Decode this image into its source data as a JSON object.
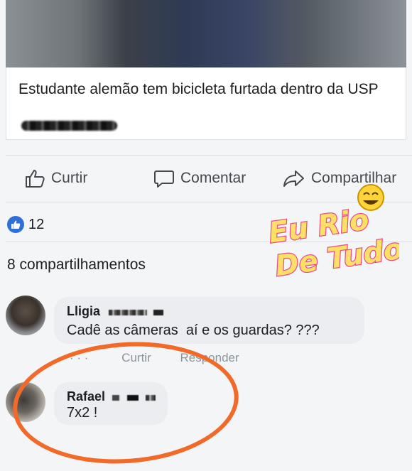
{
  "post": {
    "link_title": "Estudante alemão tem bicicleta furtada dentro da USP"
  },
  "actions": {
    "like_label": "Curtir",
    "comment_label": "Comentar",
    "share_label": "Compartilhar"
  },
  "reactions": {
    "count": "12"
  },
  "shares_text": "8 compartilhamentos",
  "comments": [
    {
      "name": "Lligia",
      "text": "Cadê as câmeras  aí e os guardas? ???"
    },
    {
      "name": "Rafael",
      "text": "7x2 !"
    }
  ],
  "comment_actions": {
    "like": "Curtir",
    "reply": "Responder"
  },
  "watermark": {
    "line1": "Eu Rio",
    "line2": "De Tudo"
  },
  "colors": {
    "like_blue": "#2e6fd8",
    "annotation_orange": "#f26a2a",
    "bubble_gray": "#ebedf0"
  }
}
